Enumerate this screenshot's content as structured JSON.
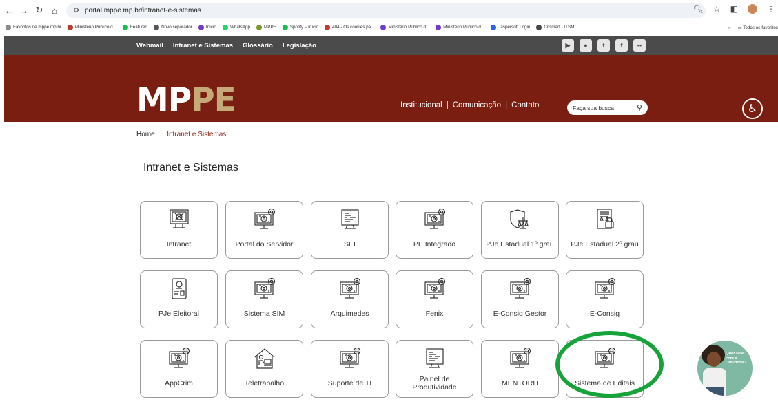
{
  "browser": {
    "url": "portal.mppe.mp.br/intranet-e-sistemas",
    "bookmarks": [
      {
        "label": "Favoritos de mppe.mp.br",
        "color": "#8a8a8a"
      },
      {
        "label": "Ministério Público d...",
        "color": "#c0392b"
      },
      {
        "label": "Featured",
        "color": "#1db954"
      },
      {
        "label": "Novo separador",
        "color": "#555555"
      },
      {
        "label": "Início",
        "color": "#6f3bd1"
      },
      {
        "label": "WhatsApp",
        "color": "#25d366"
      },
      {
        "label": "MPPE",
        "color": "#7a9a2a"
      },
      {
        "label": "Spotify – Início",
        "color": "#1db954"
      },
      {
        "label": "404 - Os cookies pa...",
        "color": "#c0392b"
      },
      {
        "label": "Ministério Público d...",
        "color": "#6f3bd1"
      },
      {
        "label": "Ministério Público d...",
        "color": "#6f3bd1"
      },
      {
        "label": "Jaspersoft Login",
        "color": "#2563eb"
      },
      {
        "label": "Citsmart - ITSM",
        "color": "#444444"
      }
    ],
    "more": "»",
    "all_favorites": "Todos os favoritos"
  },
  "topbar": {
    "links": [
      "Webmail",
      "Intranet e Sistemas",
      "Glossário",
      "Legislação"
    ],
    "social": [
      "▶",
      "●",
      "t",
      "f",
      "••"
    ]
  },
  "header": {
    "logo_mp": "MP",
    "logo_pe": "PE",
    "nav": [
      "Institucional",
      "Comunicação",
      "Contato"
    ],
    "search_placeholder": "Faça sua busca"
  },
  "breadcrumb": {
    "home": "Home",
    "current": "Intranet e Sistemas"
  },
  "page_title": "Intranet e Sistemas",
  "tiles": [
    {
      "label": "Intranet",
      "icon": "network-monitor-icon"
    },
    {
      "label": "Portal do Servidor",
      "icon": "monitor-gear-icon"
    },
    {
      "label": "SEI",
      "icon": "code-monitor-icon"
    },
    {
      "label": "PE Integrado",
      "icon": "monitor-gear-icon"
    },
    {
      "label": "PJe Estadual 1º grau",
      "icon": "shield-scales-icon"
    },
    {
      "label": "PJe Estadual 2º grau",
      "icon": "document-lock-icon"
    },
    {
      "label": "PJe Eleitoral",
      "icon": "id-document-icon"
    },
    {
      "label": "Sistema SIM",
      "icon": "monitor-gear-icon"
    },
    {
      "label": "Arquimedes",
      "icon": "monitor-gear-icon"
    },
    {
      "label": "Fenix",
      "icon": "monitor-gear-icon"
    },
    {
      "label": "E-Consig Gestor",
      "icon": "monitor-gear-icon"
    },
    {
      "label": "E-Consig",
      "icon": "monitor-gear-icon"
    },
    {
      "label": "AppCrim",
      "icon": "monitor-gear-icon"
    },
    {
      "label": "Teletrabalho",
      "icon": "home-office-icon"
    },
    {
      "label": "Suporte de TI",
      "icon": "monitor-gear-icon"
    },
    {
      "label": "Painel de Produtividade",
      "icon": "code-monitor-icon"
    },
    {
      "label": "MENTORH",
      "icon": "monitor-gear-icon"
    },
    {
      "label": "Sistema de Editais",
      "icon": "monitor-gear-icon"
    }
  ],
  "ouvidoria": "Quer falar com a Ouvidoria?",
  "colors": {
    "topbar": "#4b4b4b",
    "header": "#7a1e12",
    "logo_accent": "#c6a978",
    "highlight": "#15a33a"
  }
}
